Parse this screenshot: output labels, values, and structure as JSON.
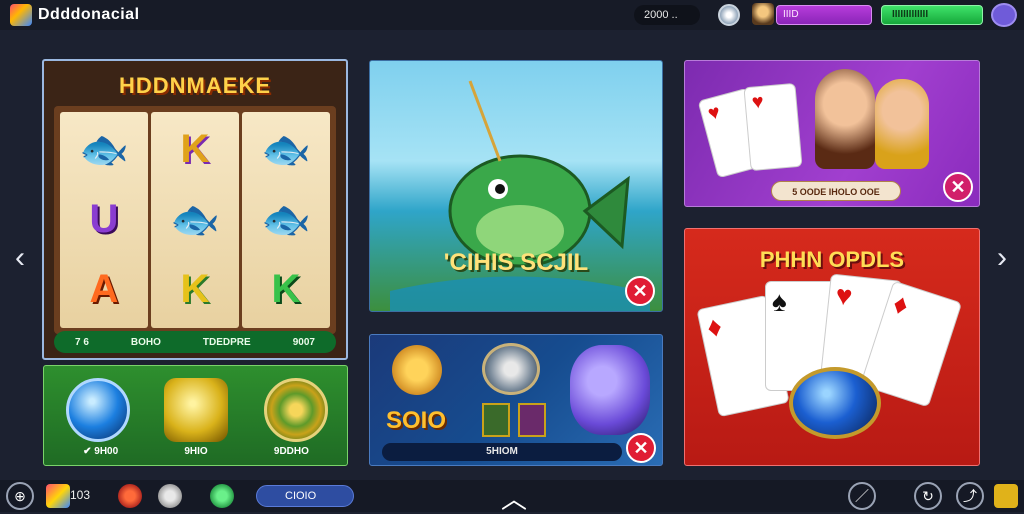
{
  "header": {
    "app_name": "Ddddonacial",
    "coins": "2000 ..",
    "purple_field": "IIID",
    "green_field": "IIIIIIIIIIIII"
  },
  "nav": {
    "left_arrow": "‹",
    "right_arrow": "›"
  },
  "slot_card": {
    "title": "HDDNMAEKE",
    "reel_symbols": [
      [
        "fish",
        "U",
        "A"
      ],
      [
        "K",
        "fish",
        "K"
      ],
      [
        "fish",
        "fish",
        "K"
      ]
    ],
    "footer": [
      "7 6",
      "BOHO",
      "TDEDPRE",
      "9007"
    ]
  },
  "gems_card": {
    "labels": [
      "✔ 9H00",
      "9HIO",
      "9DDHO"
    ]
  },
  "fish_card": {
    "title": "'CIHIS SCJIL",
    "close_label": "✕"
  },
  "ocean_card": {
    "title": "SOIO",
    "footer": "5HIOM",
    "close_label": "✕"
  },
  "poker_card": {
    "footer": "5 OODE IHOLO OOE",
    "close_label": "✕"
  },
  "cards_card": {
    "title": "PHHN OPDLS",
    "card_suits": [
      "♦",
      "♠",
      "♥",
      "♦"
    ]
  },
  "bottombar": {
    "counter": "103",
    "pill_label": "CIOIO",
    "up_chevron": "︿"
  },
  "colors": {
    "background": "#1c2130",
    "accent_purple": "#a13fcf",
    "accent_green": "#16a83a",
    "close_red": "#e01c34"
  }
}
